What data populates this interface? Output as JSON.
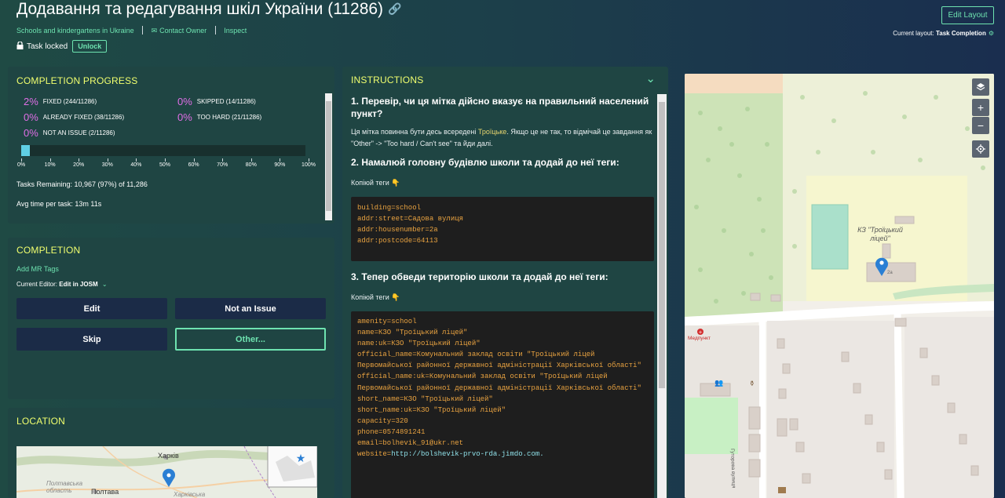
{
  "header": {
    "title": "Додавання та редагування шкіл України (11286)",
    "breadcrumb_project": "Schools and kindergartens in Ukraine",
    "contact_owner": "Contact Owner",
    "inspect": "Inspect",
    "task_locked": "Task locked",
    "unlock": "Unlock",
    "edit_layout": "Edit Layout",
    "current_layout_label": "Current layout:",
    "current_layout_value": "Task Completion"
  },
  "progress": {
    "title": "COMPLETION PROGRESS",
    "stats": [
      {
        "pct": "2%",
        "label": "FIXED (244/11286)"
      },
      {
        "pct": "0%",
        "label": "SKIPPED (14/11286)"
      },
      {
        "pct": "0%",
        "label": "ALREADY FIXED (38/11286)"
      },
      {
        "pct": "0%",
        "label": "TOO HARD (21/11286)"
      },
      {
        "pct": "0%",
        "label": "NOT AN ISSUE (2/11286)"
      }
    ],
    "bar_fraction": 0.03,
    "ticks": [
      "0%",
      "10%",
      "20%",
      "30%",
      "40%",
      "50%",
      "60%",
      "70%",
      "80%",
      "90%",
      "100%"
    ],
    "tasks_remaining": "Tasks Remaining: 10,967 (97%) of 11,286",
    "avg_time": "Avg time per task:  13m 11s"
  },
  "completion": {
    "title": "COMPLETION",
    "add_mr_tags": "Add MR Tags",
    "current_editor_label": "Current Editor:",
    "current_editor_value": "Edit in JOSM",
    "buttons": {
      "edit": "Edit",
      "not_an_issue": "Not an Issue",
      "skip": "Skip",
      "other": "Other..."
    }
  },
  "location": {
    "title": "LOCATION",
    "city1": "Харків",
    "region": "Полтавська область",
    "city2": "Полтава",
    "region2": "Харківська"
  },
  "instructions": {
    "title": "INSTRUCTIONS",
    "step1_title": "1. Перевір, чи ця мітка дійсно вказує на правильний населений пункт?",
    "step1_text_a": "Ця мітка повинна бути десь всередені ",
    "step1_place": "Троїцьке",
    "step1_text_b": ". Якщо це не так, то відмічай це завдання як \"Other\" -> \"Too hard / Can't see\" та йди далі.",
    "step2_title": "2. Намалюй головну будівлю школи та додай до неї теги:",
    "copy_tags": "Копіюй теги 👇",
    "code1": [
      "building=school",
      "addr:street=Садова вулиця",
      "addr:housenumber=2a",
      "addr:postcode=64113"
    ],
    "step3_title": "3. Тепер обведи територію школи та додай до неї теги:",
    "copy_tags2": "Копіюй теги 👇",
    "code2": [
      "amenity=school",
      "name=КЗО \"Троїцький ліцей\"",
      "name:uk=КЗО \"Троїцький ліцей\"",
      "official_name=Комунальний заклад освіти \"Троїцький ліцей Первомайської районної державної адміністрації Харківської області\"",
      "official_name:uk=Комунальний заклад освіти \"Троїцький ліцей Первомайської районної державної адміністрації Харківської області\"",
      "short_name=КЗО \"Троїцький ліцей\"",
      "short_name:uk=КЗО \"Троїцький ліцей\"",
      "capacity=320",
      "phone=0574891241",
      "email=bolhevik_91@ukr.net",
      "website=http://bolshevik-prvo-rda.jimdo.com."
    ]
  },
  "map": {
    "school_label": "КЗ \"Троїцький ліцей\"",
    "house_number": "2a",
    "medpunkt": "Медпункт",
    "street": "Гуторова вулиця",
    "controls": {
      "zoom_in": "+",
      "zoom_out": "−"
    }
  },
  "colors": {
    "accent": "#6ee3b0",
    "title_yellow": "#f1ff6e",
    "pct_magenta": "#e06ee6",
    "progress_fill": "#5fd0e4",
    "button_navy": "#1b2b47",
    "code_orange": "#e8a240",
    "marker_blue": "#2a7fd4"
  }
}
